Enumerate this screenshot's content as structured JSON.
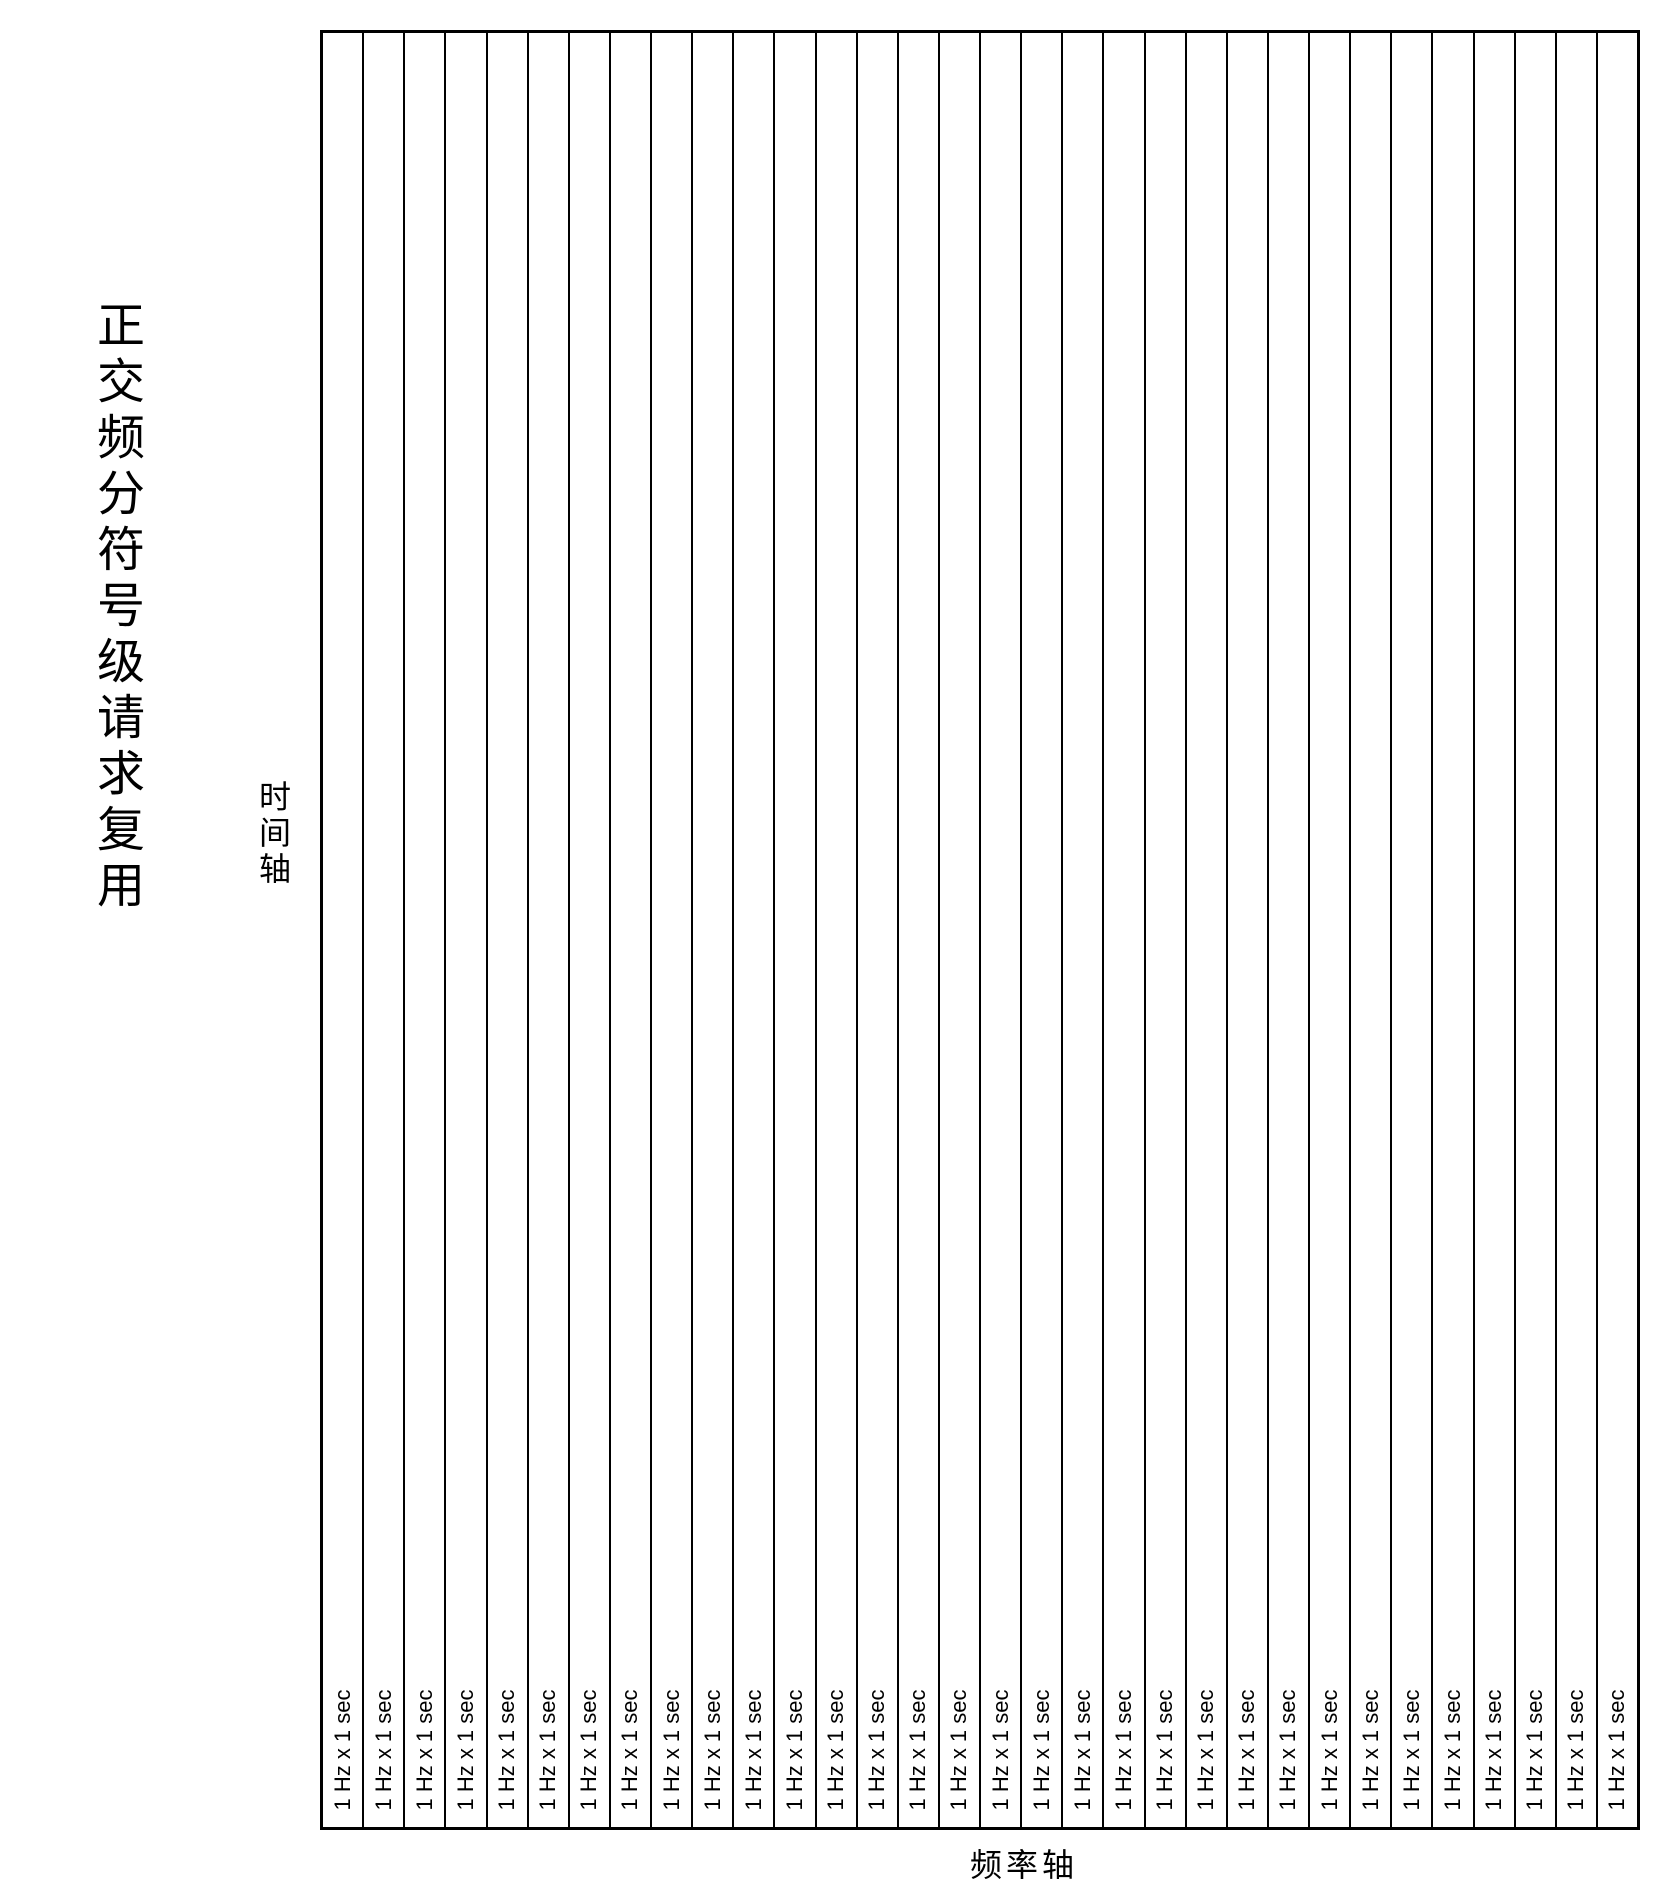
{
  "title": "正交频分符号级请求复用",
  "time_axis_label": "时间轴",
  "freq_axis_label": "频率轴",
  "cell_label": "1 Hz x 1 sec",
  "column_count": 32
}
